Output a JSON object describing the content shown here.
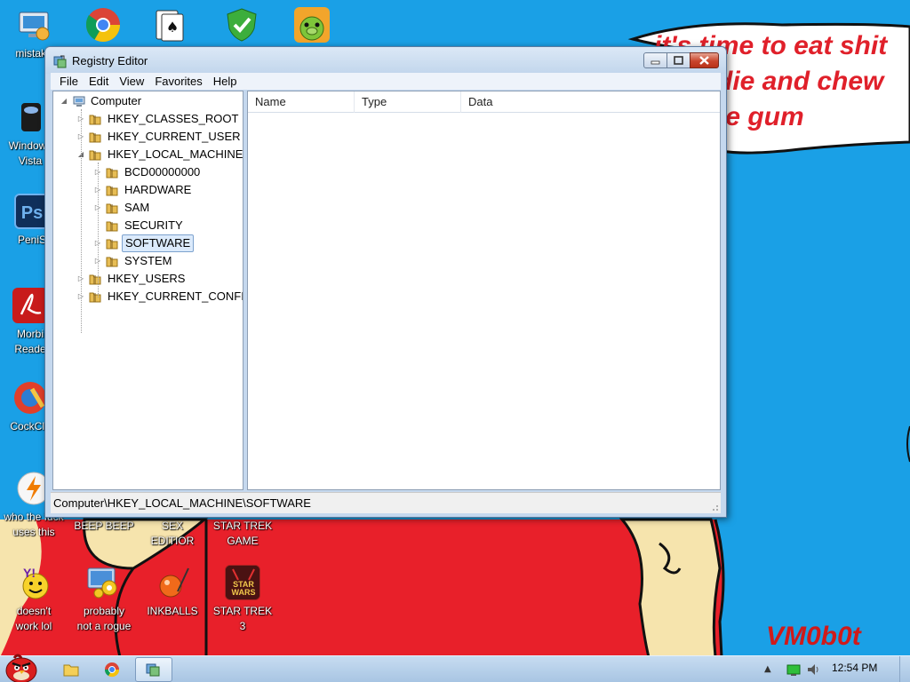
{
  "wallpaper": {
    "caption_line1": "it's time to eat shit",
    "caption_line2": "die and chew",
    "caption_line3": "le gum",
    "signature": "VM0b0t"
  },
  "desktop_icons": [
    {
      "label": "mistake",
      "icon": "computer-icon"
    },
    {
      "label": "",
      "icon": "chrome-icon"
    },
    {
      "label": "",
      "icon": "solitaire-icon"
    },
    {
      "label": "",
      "icon": "security-shield-icon"
    },
    {
      "label": "",
      "icon": "bad-piggies-icon"
    },
    {
      "label": "Windows\nVista",
      "icon": "windows-vista-icon"
    },
    {
      "label": "PeniS",
      "icon": "photoshop-icon"
    },
    {
      "label": "Morbi\nReade",
      "icon": "acrobat-reader-icon"
    },
    {
      "label": "CockCle",
      "icon": "ccleaner-icon"
    },
    {
      "label": "who the fuck\nuses this",
      "icon": "avast-icon"
    },
    {
      "label": "BEEP BEEP",
      "icon": "app-icon"
    },
    {
      "label": "SEX\nEDITIOR",
      "icon": "app-icon"
    },
    {
      "label": "STAR TREK\nGAME",
      "icon": "app-icon"
    },
    {
      "label": "doesn't\nwork lol",
      "icon": "yahoo-messenger-icon"
    },
    {
      "label": "probably\nnot a rogue",
      "icon": "settings-program-icon"
    },
    {
      "label": "INKBALLS",
      "icon": "inkball-icon"
    },
    {
      "label": "STAR TREK\n3",
      "icon": "star-wars-game-icon"
    }
  ],
  "window": {
    "title": "Registry Editor",
    "menu": [
      "File",
      "Edit",
      "View",
      "Favorites",
      "Help"
    ],
    "tree": [
      {
        "label": "Computer",
        "depth": 0,
        "expander": "expanded",
        "icon": "computer-icon"
      },
      {
        "label": "HKEY_CLASSES_ROOT",
        "depth": 1,
        "expander": "collapsed",
        "icon": "folder-icon"
      },
      {
        "label": "HKEY_CURRENT_USER",
        "depth": 1,
        "expander": "collapsed",
        "icon": "folder-icon"
      },
      {
        "label": "HKEY_LOCAL_MACHINE",
        "depth": 1,
        "expander": "expanded",
        "icon": "folder-icon"
      },
      {
        "label": "BCD00000000",
        "depth": 2,
        "expander": "collapsed",
        "icon": "folder-icon"
      },
      {
        "label": "HARDWARE",
        "depth": 2,
        "expander": "collapsed",
        "icon": "folder-icon"
      },
      {
        "label": "SAM",
        "depth": 2,
        "expander": "collapsed",
        "icon": "folder-icon"
      },
      {
        "label": "SECURITY",
        "depth": 2,
        "expander": "none",
        "icon": "folder-icon"
      },
      {
        "label": "SOFTWARE",
        "depth": 2,
        "expander": "collapsed",
        "icon": "folder-icon",
        "selected": true
      },
      {
        "label": "SYSTEM",
        "depth": 2,
        "expander": "collapsed",
        "icon": "folder-icon"
      },
      {
        "label": "HKEY_USERS",
        "depth": 1,
        "expander": "collapsed",
        "icon": "folder-icon"
      },
      {
        "label": "HKEY_CURRENT_CONFIG",
        "depth": 1,
        "expander": "collapsed",
        "icon": "folder-icon"
      }
    ],
    "columns": [
      "Name",
      "Type",
      "Data"
    ],
    "status_path": "Computer\\HKEY_LOCAL_MACHINE\\SOFTWARE"
  },
  "taskbar": {
    "pinned": [
      "windows-explorer-icon",
      "chrome-icon",
      "registry-editor-icon"
    ],
    "clock": "12:54 PM",
    "tray_icons": [
      "network-icon",
      "volume-icon"
    ]
  },
  "colors": {
    "desktop_blue": "#1aa0e6",
    "wall_red": "#e0202a",
    "selection": "#dbeafb"
  }
}
